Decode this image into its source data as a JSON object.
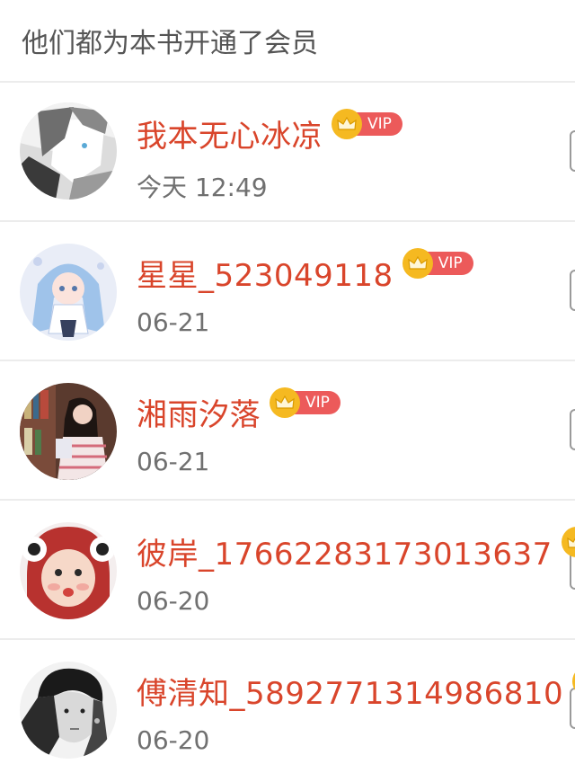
{
  "header": {
    "title": "他们都为本书开通了会员"
  },
  "vip_label": "VIP",
  "colors": {
    "name": "#d9452b",
    "vip_crown": "#f5b921",
    "vip_pill": "#ec5a5a",
    "date": "#707070"
  },
  "members": [
    {
      "name": "我本无心冰凉",
      "date": "今天 12:49",
      "avatar": "grey-manga-boy"
    },
    {
      "name": "星星_523049118",
      "date": "06-21",
      "avatar": "blue-hair-anime-girl"
    },
    {
      "name": "湘雨汐落",
      "date": "06-21",
      "avatar": "girl-in-bookstore"
    },
    {
      "name": "彼岸_17662283173013637",
      "date": "06-20",
      "avatar": "baby-red-hood"
    },
    {
      "name": "傅清知_5892771314986810",
      "date": "06-20",
      "avatar": "monochrome-young-man"
    }
  ]
}
